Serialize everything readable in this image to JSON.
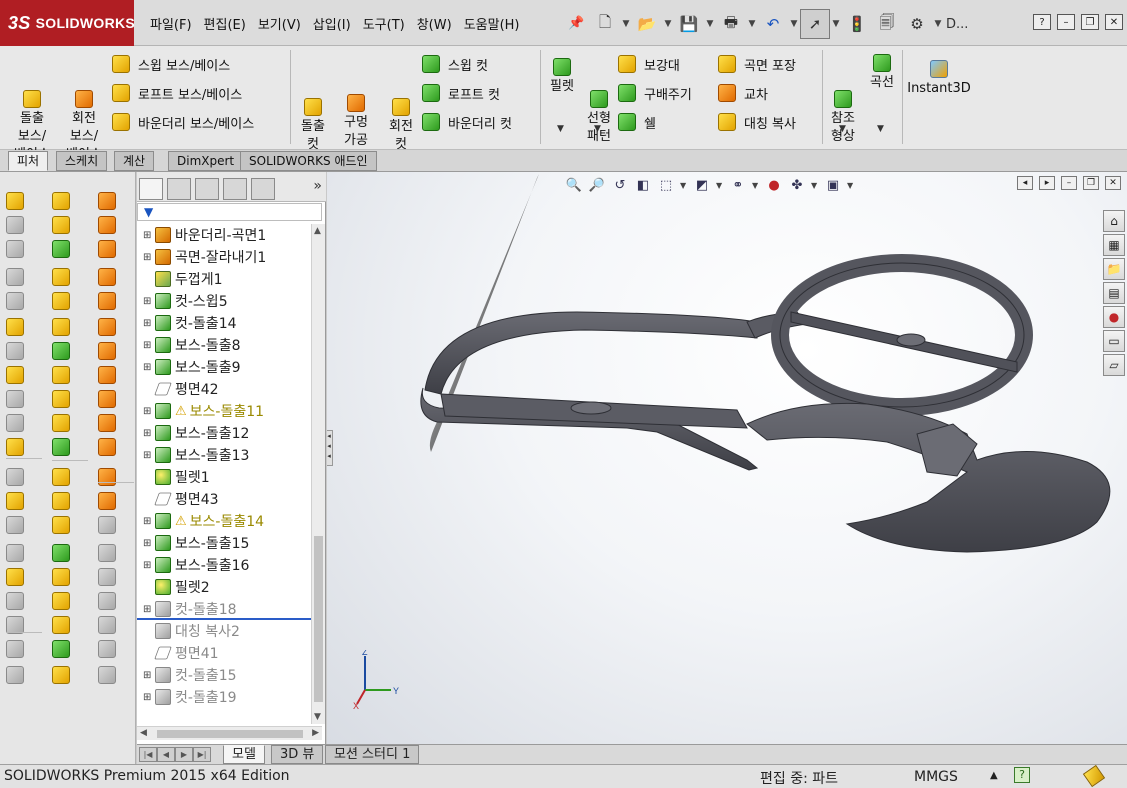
{
  "app": {
    "logo_text": "SOLIDWORKS",
    "logo_prefix": "3S"
  },
  "menu": [
    "파일(F)",
    "편집(E)",
    "보기(V)",
    "삽입(I)",
    "도구(T)",
    "창(W)",
    "도움말(H)"
  ],
  "title_short": "D...",
  "ribbon": {
    "extrude_boss": "돌출\n보스/\n베이스",
    "revolve_boss": "회전\n보스/\n베이스",
    "sweep_boss": "스윕 보스/베이스",
    "loft_boss": "로프트 보스/베이스",
    "boundary_boss": "바운더리 보스/베이스",
    "extrude_cut": "돌출\n컷",
    "hole_wizard": "구멍\n가공\n마법사",
    "revolve_cut": "회전\n컷",
    "sweep_cut": "스윕 컷",
    "loft_cut": "로프트 컷",
    "boundary_cut": "바운더리 컷",
    "fillet": "필렛",
    "linear_pattern": "선형\n패턴",
    "rib": "보강대",
    "draft": "구배주기",
    "shell": "쉘",
    "wrap": "곡면 포장",
    "intersect": "교차",
    "mirror": "대칭 복사",
    "ref_geometry": "참조\n형상",
    "curves": "곡선",
    "instant3d": "Instant3D"
  },
  "cm_tabs": [
    "피처",
    "스케치",
    "계산",
    "DimXpert",
    "SOLIDWORKS 애드인"
  ],
  "tree": {
    "items": [
      {
        "label": "바운더리-곡면1",
        "icon": "boundary-surface-icon",
        "state": "normal",
        "expand": true
      },
      {
        "label": "곡면-잘라내기1",
        "icon": "surface-cut-icon",
        "state": "normal",
        "expand": true
      },
      {
        "label": "두껍게1",
        "icon": "thicken-icon",
        "state": "normal",
        "expand": false
      },
      {
        "label": "컷-스윕5",
        "icon": "cut-sweep-icon",
        "state": "normal",
        "expand": true
      },
      {
        "label": "컷-돌출14",
        "icon": "cut-extrude-icon",
        "state": "normal",
        "expand": true
      },
      {
        "label": "보스-돌출8",
        "icon": "boss-extrude-icon",
        "state": "normal",
        "expand": true
      },
      {
        "label": "보스-돌출9",
        "icon": "boss-extrude-icon",
        "state": "normal",
        "expand": true
      },
      {
        "label": "평면42",
        "icon": "plane-icon",
        "state": "normal",
        "expand": false
      },
      {
        "label": "보스-돌출11",
        "icon": "boss-extrude-icon",
        "state": "warning",
        "expand": true
      },
      {
        "label": "보스-돌출12",
        "icon": "boss-extrude-icon",
        "state": "normal",
        "expand": true
      },
      {
        "label": "보스-돌출13",
        "icon": "boss-extrude-icon",
        "state": "normal",
        "expand": true
      },
      {
        "label": "필렛1",
        "icon": "fillet-icon",
        "state": "normal",
        "expand": false
      },
      {
        "label": "평면43",
        "icon": "plane-icon",
        "state": "normal",
        "expand": false
      },
      {
        "label": "보스-돌출14",
        "icon": "boss-extrude-icon",
        "state": "warning",
        "expand": true
      },
      {
        "label": "보스-돌출15",
        "icon": "boss-extrude-icon",
        "state": "normal",
        "expand": true
      },
      {
        "label": "보스-돌출16",
        "icon": "boss-extrude-icon",
        "state": "normal",
        "expand": true
      },
      {
        "label": "필렛2",
        "icon": "fillet-icon",
        "state": "normal",
        "expand": false
      },
      {
        "label": "컷-돌출18",
        "icon": "cut-extrude-icon",
        "state": "suppressed",
        "expand": true
      },
      {
        "label": "대칭 복사2",
        "icon": "mirror-icon",
        "state": "suppressed",
        "expand": false
      },
      {
        "label": "평면41",
        "icon": "plane-icon",
        "state": "suppressed",
        "expand": false
      },
      {
        "label": "컷-돌출15",
        "icon": "cut-extrude-icon",
        "state": "suppressed",
        "expand": true
      },
      {
        "label": "컷-돌출19",
        "icon": "cut-extrude-icon",
        "state": "suppressed",
        "expand": true
      }
    ]
  },
  "bottom_tabs": [
    "모델",
    "3D 뷰",
    "모션 스터디 1"
  ],
  "status": {
    "product": "SOLIDWORKS Premium 2015 x64 Edition",
    "mode": "편집 중: 파트",
    "units": "MMGS"
  },
  "triad": {
    "x": "X",
    "y": "Y",
    "z": "Z"
  },
  "colors": {
    "brand": "#b01e23",
    "model": "#4f5058",
    "rollback": "#2a5cc8",
    "warning": "#d4a000"
  }
}
